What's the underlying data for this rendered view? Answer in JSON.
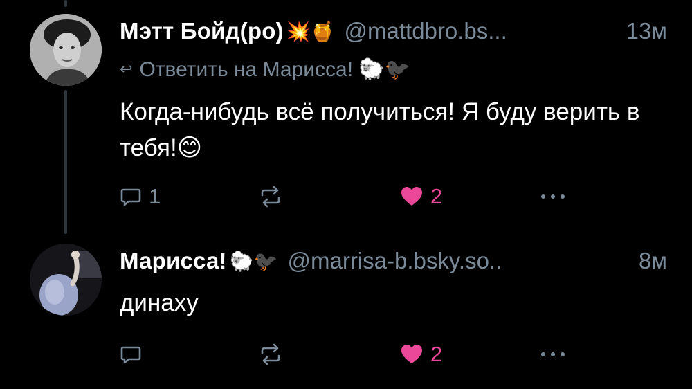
{
  "posts": [
    {
      "author": "Мэтт Бойд(ро)",
      "name_emoji": "💥🍯",
      "handle": "@mattdbro.bs...",
      "time": "13м",
      "reply_to": "Ответить на Марисса! 🐑🐦‍⬛",
      "text": "Когда-нибудь всё получиться! Я буду верить в тебя!😊",
      "reply_count": "1",
      "like_count": "2"
    },
    {
      "author": "Марисса!",
      "name_emoji": "🐑🐦‍⬛",
      "handle": "@marrisa-b.bsky.so..",
      "time": "8м",
      "text": "динаху",
      "reply_count": "",
      "like_count": "2"
    }
  ],
  "colors": {
    "background": "#000000",
    "muted": "#7b8a99",
    "like": "#ec4899",
    "thread_line": "#2e3640"
  },
  "icons": [
    "reply-arrow-icon",
    "comment-icon",
    "repost-icon",
    "heart-icon",
    "more-icon"
  ]
}
